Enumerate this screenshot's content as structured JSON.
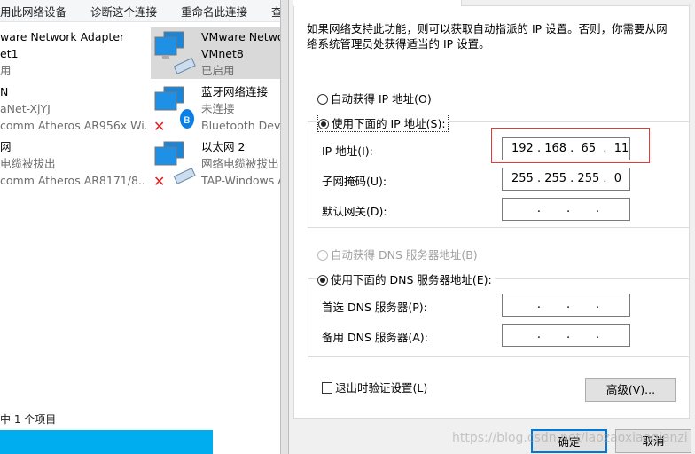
{
  "explorer": {
    "toolbar": [
      "用此网络设备",
      "诊断这个连接",
      "重命名此连接",
      "查"
    ],
    "adapters": [
      {
        "name": "ware Network Adapter",
        "line2": "et1",
        "status": "用"
      },
      {
        "name": "VMware Netwo",
        "line2": "VMnet8",
        "status": "已启用",
        "selected": true
      },
      {
        "name": "N",
        "line2": "aNet-XjYJ",
        "status": "comm Atheros AR956x Wi..."
      },
      {
        "name": "蓝牙网络连接",
        "line2": "未连接",
        "status": "Bluetooth Devic"
      },
      {
        "name": "网",
        "line2": "电缆被拔出",
        "status": "comm Atheros AR8171/8..."
      },
      {
        "name": "以太网 2",
        "line2": "网络电缆被拔出",
        "status": "TAP-Windows A"
      }
    ],
    "status_text": "中 1 个项目"
  },
  "dialog": {
    "description_line1": "如果网络支持此功能，则可以获取自动指派的 IP 设置。否则，你需要从网",
    "description_line2": "络系统管理员处获得适当的 IP 设置。",
    "auto_ip": "自动获得 IP 地址(O)",
    "manual_ip": "使用下面的 IP 地址(S):",
    "ip_label": "IP 地址(I):",
    "ip_value": "192 . 168 .  65  .  11",
    "mask_label": "子网掩码(U):",
    "mask_value": "255 . 255 . 255 .  0",
    "gateway_label": "默认网关(D):",
    "gateway_value": "       .       .       .",
    "auto_dns": "自动获得 DNS 服务器地址(B)",
    "manual_dns": "使用下面的 DNS 服务器地址(E):",
    "dns1_label": "首选 DNS 服务器(P):",
    "dns1_value": "       .       .       .",
    "dns2_label": "备用 DNS 服务器(A):",
    "dns2_value": "       .       .       .",
    "validate": "退出时验证设置(L)",
    "advanced": "高级(V)...",
    "ok": "确定",
    "cancel": "取消",
    "highlight_color": "#e53935"
  },
  "watermark": "https://blog.csdn.net/laozaoxiaoqianzi"
}
